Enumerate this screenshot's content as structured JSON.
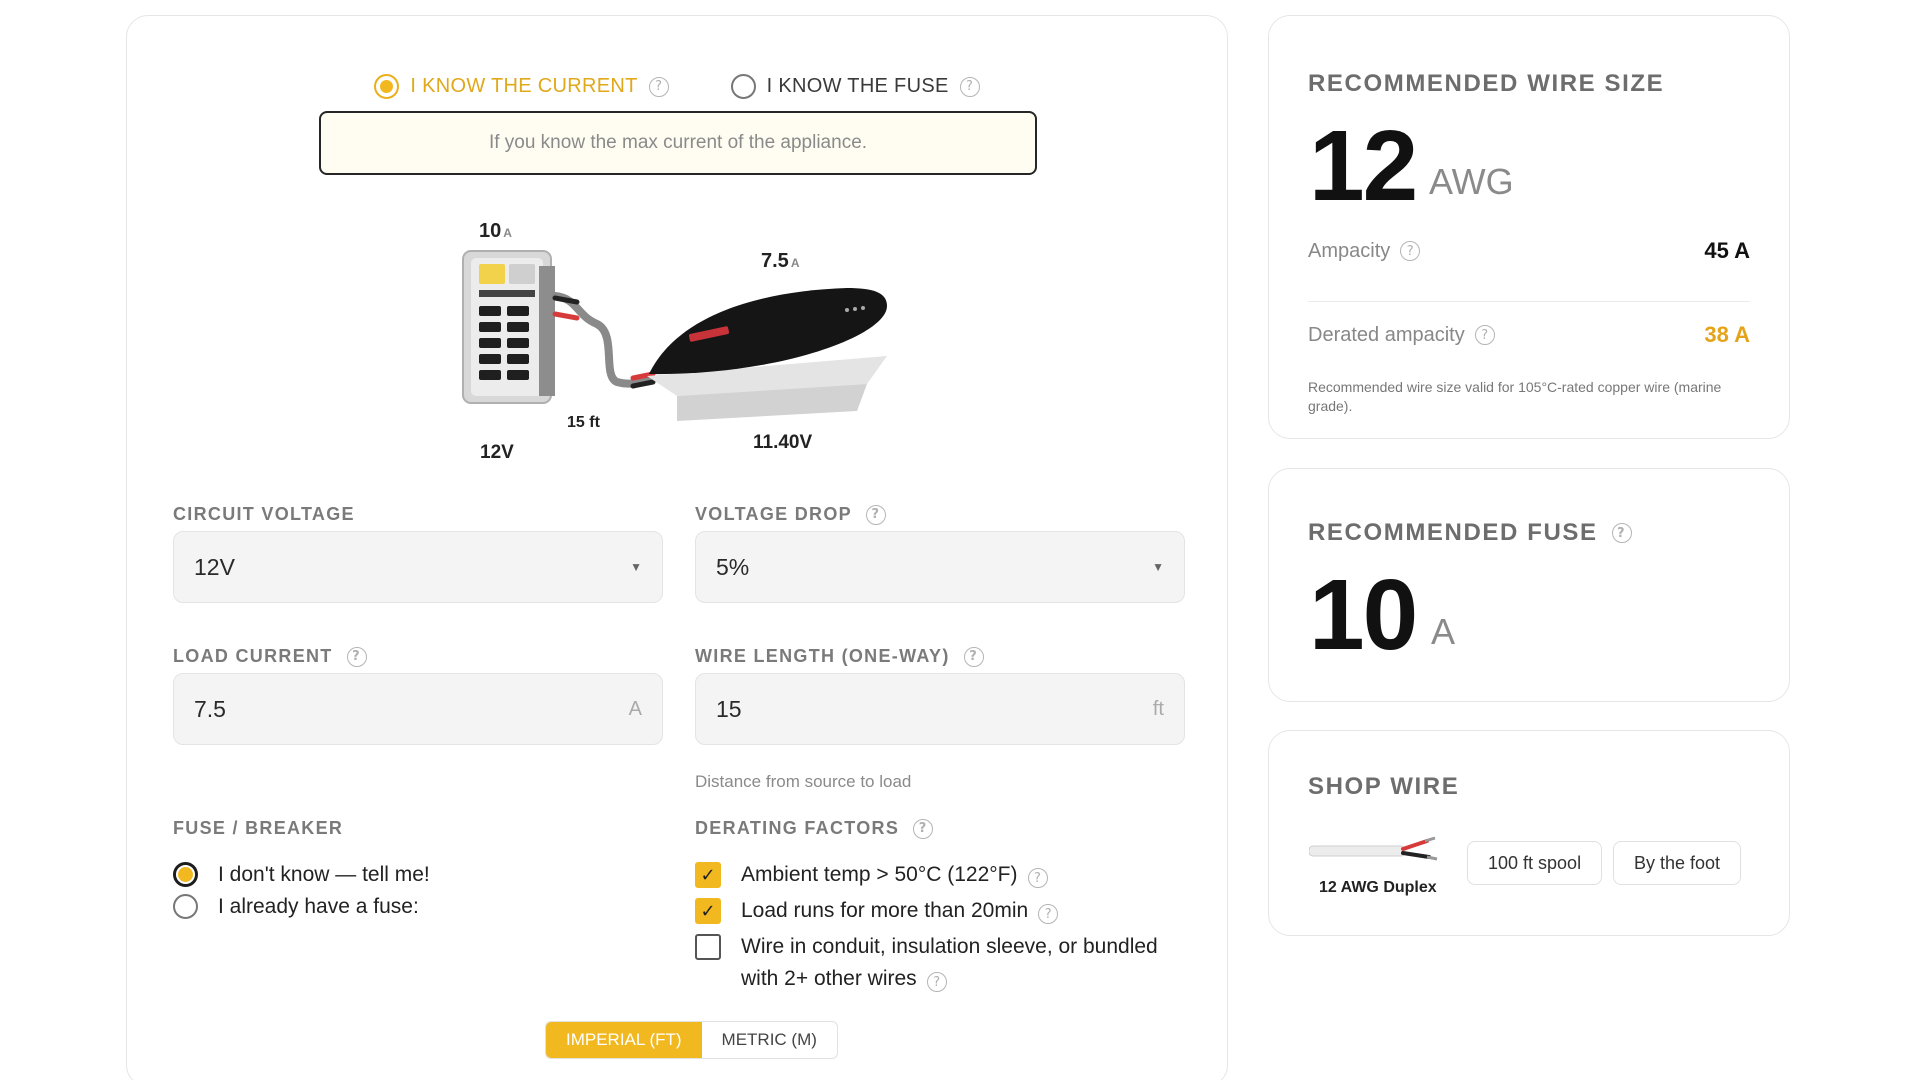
{
  "mode": {
    "current_label": "I KNOW THE CURRENT",
    "fuse_label": "I KNOW THE FUSE",
    "selected": "current"
  },
  "info_text": "If you know the max current of the appliance.",
  "diagram": {
    "source_current": "10",
    "load_current": "7.5",
    "current_unit": "A",
    "source_voltage": "12V",
    "load_voltage": "11.40V",
    "length": "15 ft"
  },
  "circuit_voltage": {
    "label": "CIRCUIT VOLTAGE",
    "value": "12V"
  },
  "voltage_drop": {
    "label": "VOLTAGE DROP",
    "value": "5%"
  },
  "load_current": {
    "label": "LOAD CURRENT",
    "value": "7.5",
    "unit": "A"
  },
  "wire_length": {
    "label": "WIRE LENGTH (ONE-WAY)",
    "value": "15",
    "unit": "ft",
    "hint": "Distance from source to load"
  },
  "fuse_breaker": {
    "label": "FUSE / BREAKER",
    "options": [
      {
        "label": "I don't know — tell me!",
        "selected": true
      },
      {
        "label": "I already have a fuse:",
        "selected": false
      }
    ]
  },
  "derating": {
    "label": "DERATING FACTORS",
    "items": [
      {
        "label": "Ambient temp > 50°C (122°F)",
        "checked": true
      },
      {
        "label": "Load runs for more than 20min",
        "checked": true
      },
      {
        "label": "Wire in conduit, insulation sleeve, or bundled with 2+ other wires",
        "checked": false
      }
    ]
  },
  "units": {
    "imperial": "IMPERIAL (FT)",
    "metric": "METRIC (M)",
    "selected": "imperial"
  },
  "wire": {
    "title": "RECOMMENDED WIRE SIZE",
    "size": "12",
    "unit": "AWG",
    "ampacity_label": "Ampacity",
    "ampacity_value": "45 A",
    "derated_label": "Derated ampacity",
    "derated_value": "38 A",
    "note": "Recommended wire size valid for 105°C-rated copper wire (marine grade)."
  },
  "fuse": {
    "title": "RECOMMENDED FUSE",
    "value": "10",
    "unit": "A"
  },
  "shop": {
    "title": "SHOP WIRE",
    "product": "12 AWG Duplex",
    "spool_label": "100 ft spool",
    "foot_label": "By the foot"
  },
  "colors": {
    "accent": "#f2b81f",
    "accent_text": "#e5a319"
  }
}
